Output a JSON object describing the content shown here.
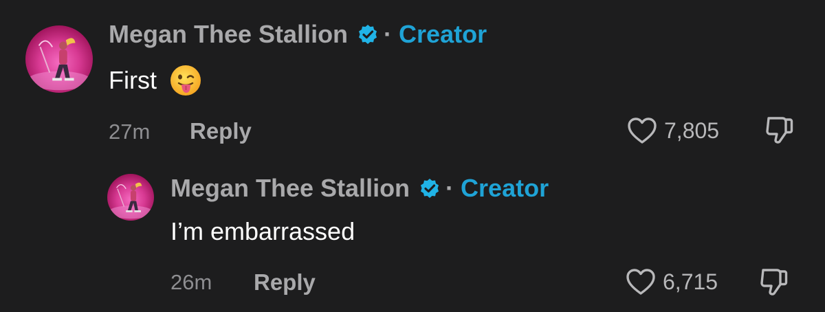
{
  "comments": [
    {
      "author": "Megan Thee Stallion",
      "separator": "·",
      "badge": "Creator",
      "text": "First",
      "emoji": "face-with-tongue",
      "time": "27m",
      "reply_label": "Reply",
      "likes": "7,805"
    },
    {
      "author": "Megan Thee Stallion",
      "separator": "·",
      "badge": "Creator",
      "text": "I’m embarrassed",
      "time": "26m",
      "reply_label": "Reply",
      "likes": "6,715"
    }
  ],
  "colors": {
    "background": "#1d1d1e",
    "name": "#a9a9ab",
    "creator_badge": "#1fa3d6",
    "verified": "#20b3e6",
    "body_text": "#ffffff"
  },
  "icons": [
    "verified-badge-icon",
    "heart-icon",
    "thumbs-down-icon",
    "tongue-emoji-icon"
  ]
}
